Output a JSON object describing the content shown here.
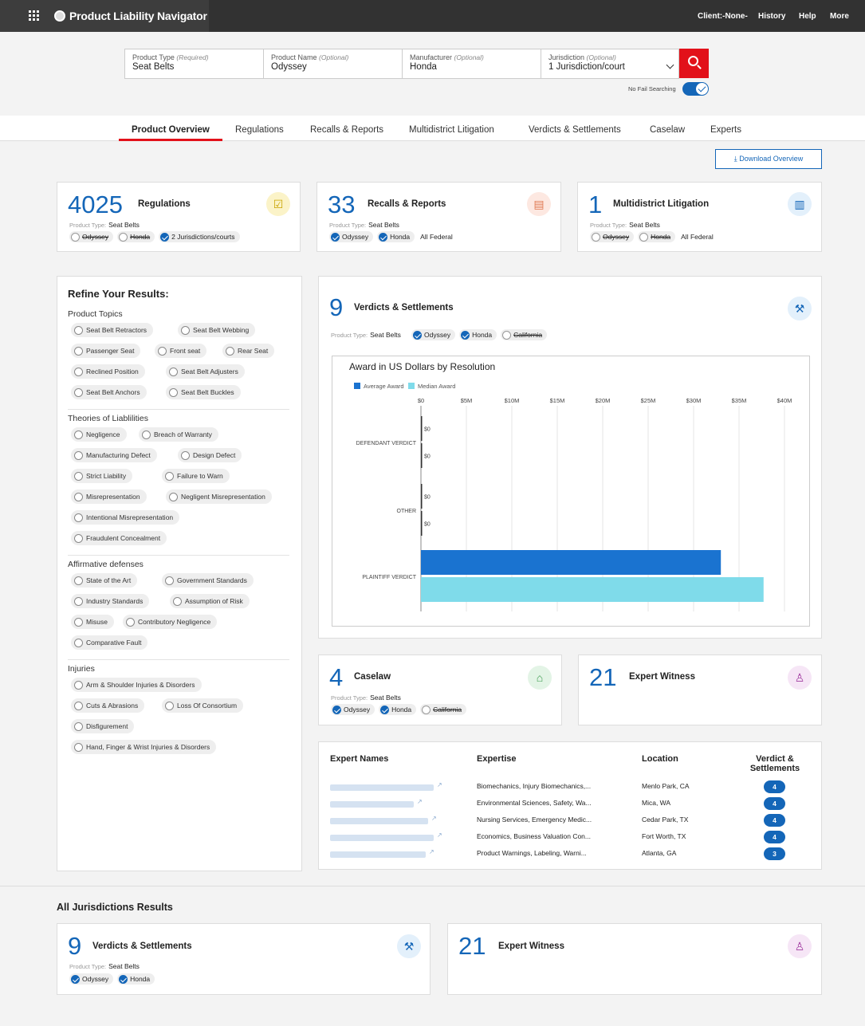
{
  "header": {
    "app_title": "Product Liability Navigator",
    "client": "Client:-None-",
    "history": "History",
    "help": "Help",
    "more": "More"
  },
  "search": {
    "fields": [
      {
        "label": "Product Type",
        "qualifier": "(Required)",
        "value": "Seat Belts"
      },
      {
        "label": "Product Name",
        "qualifier": "(Optional)",
        "value": "Odyssey"
      },
      {
        "label": "Manufacturer",
        "qualifier": "(Optional)",
        "value": "Honda"
      },
      {
        "label": "Jurisdiction",
        "qualifier": "(Optional)",
        "value": "1 Jurisdiction/court"
      }
    ],
    "no_fail_label": "No Fail Searching",
    "no_fail_on": true
  },
  "tabs": [
    "Product Overview",
    "Regulations",
    "Recalls & Reports",
    "Multidistrict Litigation",
    "Verdicts & Settlements",
    "Caselaw",
    "Experts"
  ],
  "download_label": "Download Overview",
  "product_type_key": "Product Type:",
  "product_type_value": "Seat Belts",
  "cards": {
    "regulations": {
      "count": "4025",
      "title": "Regulations",
      "chips": [
        {
          "t": "Odyssey",
          "on": false
        },
        {
          "t": "Honda",
          "on": false
        },
        {
          "t": "2 Jurisdictions/courts",
          "on": true
        }
      ],
      "extra": ""
    },
    "recalls": {
      "count": "33",
      "title": "Recalls & Reports",
      "chips": [
        {
          "t": "Odyssey",
          "on": true
        },
        {
          "t": "Honda",
          "on": true
        }
      ],
      "extra": "All Federal"
    },
    "mdl": {
      "count": "1",
      "title": "Multidistrict Litigation",
      "chips": [
        {
          "t": "Odyssey",
          "on": false
        },
        {
          "t": "Honda",
          "on": false
        }
      ],
      "extra": "All Federal"
    },
    "verdicts": {
      "count": "9",
      "title": "Verdicts & Settlements",
      "chips": [
        {
          "t": "Odyssey",
          "on": true
        },
        {
          "t": "Honda",
          "on": true
        },
        {
          "t": "California",
          "on": false
        }
      ]
    },
    "caselaw": {
      "count": "4",
      "title": "Caselaw",
      "chips": [
        {
          "t": "Odyssey",
          "on": true
        },
        {
          "t": "Honda",
          "on": true
        },
        {
          "t": "California",
          "on": false
        }
      ]
    },
    "expert": {
      "count": "21",
      "title": "Expert Witness"
    }
  },
  "refine": {
    "title": "Refine Your Results:",
    "sections": [
      {
        "title": "Product Topics",
        "rows": [
          [
            "Seat Belt Retractors",
            "Seat Belt Webbing"
          ],
          [
            "Passenger Seat",
            "Front seat",
            "Rear Seat"
          ],
          [
            "Reclined Position",
            "Seat Belt Adjusters"
          ],
          [
            "Seat Belt Anchors",
            "Seat Belt Buckles"
          ]
        ]
      },
      {
        "title": "Theories of Liablilities",
        "rows": [
          [
            "Negligence",
            "Breach of Warranty"
          ],
          [
            "Manufacturing Defect",
            "Design Defect"
          ],
          [
            "Strict Liability",
            "Failure to Warn"
          ],
          [
            "Misrepresentation",
            "Negligent Misrepresentation"
          ],
          [
            "Intentional Misrepresentation"
          ],
          [
            "Fraudulent Concealment"
          ]
        ]
      },
      {
        "title": "Affirmative defenses",
        "rows": [
          [
            "State of the Art",
            "Government Standards"
          ],
          [
            "Industry Standards",
            "Assumption of Risk"
          ],
          [
            "Misuse",
            "Contributory Negligence"
          ],
          [
            "Comparative Fault"
          ]
        ]
      },
      {
        "title": "Injuries",
        "rows": [
          [
            "Arm & Shoulder Injuries & Disorders"
          ],
          [
            "Cuts & Abrasions",
            "Loss Of Consortium"
          ],
          [
            "Disfigurement"
          ],
          [
            "Hand, Finger & Wrist Injuries & Disorders"
          ]
        ]
      }
    ]
  },
  "chart_data": {
    "type": "bar",
    "orientation": "horizontal",
    "title": "Award in US Dollars by Resolution",
    "categories": [
      "DEFENDANT VERDICT",
      "OTHER",
      "PLAINTIFF VERDICT"
    ],
    "series": [
      {
        "name": "Average Award",
        "values": [
          0,
          0,
          33000000
        ],
        "color": "#1a73d0"
      },
      {
        "name": "Median Award",
        "values": [
          0,
          0,
          37700000
        ],
        "color": "#7fdbea"
      }
    ],
    "ticks": [
      "$0",
      "$5M",
      "$10M",
      "$15M",
      "$20M",
      "$25M",
      "$30M",
      "$35M",
      "$40M"
    ],
    "xlim": [
      0,
      40000000
    ],
    "zero_label": "$0",
    "grid": true,
    "legend_position": "top-left"
  },
  "experts": {
    "headers": {
      "name": "Expert Names",
      "expertise": "Expertise",
      "location": "Location",
      "verdicts": "Verdict & Settlements"
    },
    "rows": [
      {
        "expertise": "Biomechanics, Injury Biomechanics,...",
        "location": "Menlo Park, CA",
        "count": "4"
      },
      {
        "expertise": "Environmental Sciences, Safety, Wa...",
        "location": "Mica, WA",
        "count": "4"
      },
      {
        "expertise": "Nursing Services, Emergency Medic...",
        "location": "Cedar Park, TX",
        "count": "4"
      },
      {
        "expertise": "Economics, Business Valuation Con...",
        "location": "Fort Worth, TX",
        "count": "4"
      },
      {
        "expertise": "Product Warnings, Labeling, Warni...",
        "location": "Atlanta, GA",
        "count": "3"
      }
    ]
  },
  "all_jurisdictions": {
    "title": "All Jurisdictions Results",
    "verdicts": {
      "count": "9",
      "title": "Verdicts & Settlements",
      "chips": [
        {
          "t": "Odyssey",
          "on": true
        },
        {
          "t": "Honda",
          "on": true
        }
      ]
    },
    "expert": {
      "count": "21",
      "title": "Expert Witness"
    }
  },
  "icons": {
    "apps": "apps-grid-icon",
    "logo": "logo-icon",
    "search": "search-icon",
    "download": "download-icon",
    "regulations": "checklist-icon",
    "recalls": "document-icon",
    "mdl": "bar-chart-icon",
    "verdicts": "gavel-icon",
    "caselaw": "courthouse-icon",
    "expert": "person-icon"
  },
  "colors": {
    "accent": "#1466b8",
    "brand_red": "#e2111a",
    "topbar": "#323232"
  }
}
